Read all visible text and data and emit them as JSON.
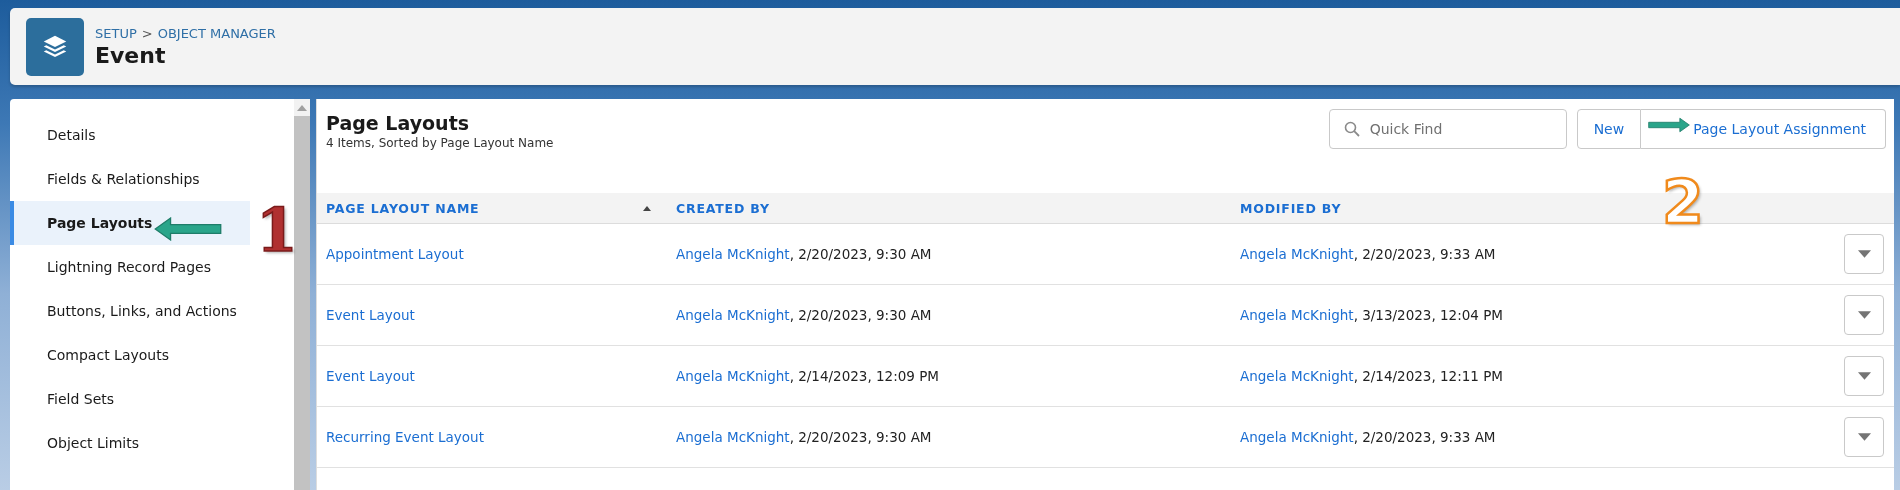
{
  "header": {
    "breadcrumb": [
      {
        "label": "SETUP"
      },
      {
        "label": "OBJECT MANAGER"
      }
    ],
    "separator": ">",
    "title": "Event"
  },
  "sidebar": {
    "items": [
      {
        "label": "Details",
        "selected": false
      },
      {
        "label": "Fields & Relationships",
        "selected": false
      },
      {
        "label": "Page Layouts",
        "selected": true
      },
      {
        "label": "Lightning Record Pages",
        "selected": false
      },
      {
        "label": "Buttons, Links, and Actions",
        "selected": false
      },
      {
        "label": "Compact Layouts",
        "selected": false
      },
      {
        "label": "Field Sets",
        "selected": false
      },
      {
        "label": "Object Limits",
        "selected": false
      }
    ]
  },
  "main": {
    "title": "Page Layouts",
    "subtitle": "4 Items, Sorted by Page Layout Name",
    "search": {
      "placeholder": "Quick Find"
    },
    "buttons": [
      {
        "label": "New"
      },
      {
        "label": "Page Layout Assignment"
      }
    ],
    "table": {
      "columns": [
        {
          "label": "PAGE LAYOUT NAME",
          "sorted": true
        },
        {
          "label": "CREATED BY",
          "sorted": false
        },
        {
          "label": "MODIFIED BY",
          "sorted": false
        }
      ],
      "rows": [
        {
          "name": "Appointment Layout",
          "created_user": "Angela McKnight",
          "created_date": ", 2/20/2023, 9:30 AM",
          "modified_user": "Angela McKnight",
          "modified_date": ", 2/20/2023, 9:33 AM"
        },
        {
          "name": "Event Layout",
          "created_user": "Angela McKnight",
          "created_date": ", 2/20/2023, 9:30 AM",
          "modified_user": "Angela McKnight",
          "modified_date": ", 3/13/2023, 12:04 PM"
        },
        {
          "name": "Event Layout",
          "created_user": "Angela McKnight",
          "created_date": ", 2/14/2023, 12:09 PM",
          "modified_user": "Angela McKnight",
          "modified_date": ", 2/14/2023, 12:11 PM"
        },
        {
          "name": "Recurring Event Layout",
          "created_user": "Angela McKnight",
          "created_date": ", 2/20/2023, 9:30 AM",
          "modified_user": "Angela McKnight",
          "modified_date": ", 2/20/2023, 9:33 AM"
        }
      ]
    }
  },
  "annotations": [
    {
      "label": "1",
      "kind": "red"
    },
    {
      "label": "2",
      "kind": "orange"
    }
  ]
}
